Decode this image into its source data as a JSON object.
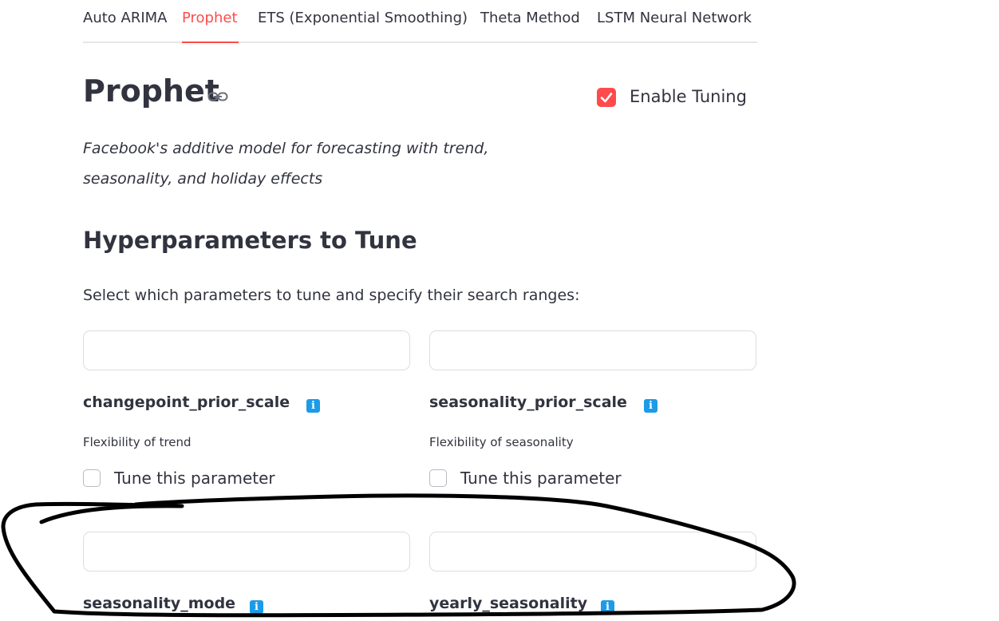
{
  "tabs": [
    {
      "label": "Auto ARIMA",
      "active": false
    },
    {
      "label": "Prophet",
      "active": true
    },
    {
      "label": "ETS (Exponential Smoothing)",
      "active": false
    },
    {
      "label": "Theta Method",
      "active": false
    },
    {
      "label": "LSTM Neural Network",
      "active": false
    }
  ],
  "model": {
    "title": "Prophet",
    "description_line1": "Facebook's additive model for forecasting with trend,",
    "description_line2": "seasonality, and holiday effects",
    "enable_tuning_label": "Enable Tuning",
    "enable_tuning_checked": true
  },
  "hyperparams": {
    "heading": "Hyperparameters to Tune",
    "intro": "Select which parameters to tune and specify their search ranges:",
    "params": [
      {
        "name": "changepoint_prior_scale",
        "description": "Flexibility of trend",
        "tune_label": "Tune this parameter",
        "tune_checked": false
      },
      {
        "name": "seasonality_prior_scale",
        "description": "Flexibility of seasonality",
        "tune_label": "Tune this parameter",
        "tune_checked": false
      },
      {
        "name": "seasonality_mode"
      },
      {
        "name": "yearly_seasonality"
      }
    ],
    "info_glyph": "i"
  },
  "colors": {
    "accent": "#ff4b4b",
    "info": "#1c9be8",
    "text": "#31333f",
    "annotation_stroke": "#000000"
  },
  "icons": {
    "heading_anchor": "link-icon",
    "info": "info-icon",
    "checkbox_checked": "checkbox-checked-icon"
  }
}
